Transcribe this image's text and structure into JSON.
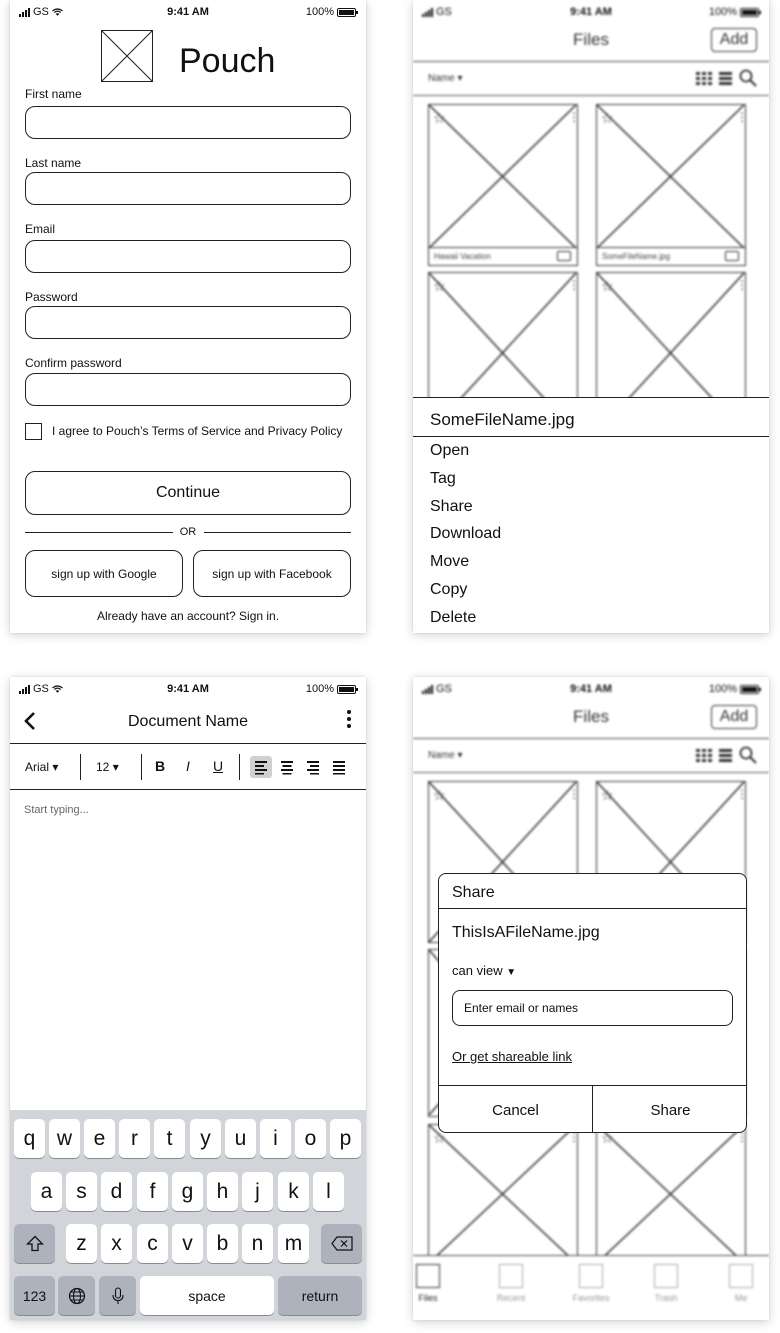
{
  "status_bar": {
    "carrier": "GS",
    "time": "9:41 AM",
    "battery": "100%"
  },
  "signup": {
    "brand": "Pouch",
    "fields": [
      {
        "label": "First name"
      },
      {
        "label": "Last name"
      },
      {
        "label": "Email"
      },
      {
        "label": "Password"
      },
      {
        "label": "Confirm password"
      }
    ],
    "terms_text": "I agree to Pouch’s Terms of Service and Privacy Policy",
    "continue_label": "Continue",
    "or_text": "OR",
    "google_label": "sign up with Google",
    "facebook_label": "sign up with Facebook",
    "signin_text": "Already have an account? Sign in."
  },
  "files": {
    "title": "Files",
    "add_label": "Add",
    "sort_label": "Name ▾",
    "tile_names": [
      "Hawaii Vacation",
      "SomeFileName.jpg"
    ],
    "tabs": [
      "Files",
      "Recent",
      "Favorites",
      "Trash",
      "Me"
    ]
  },
  "action_sheet": {
    "title": "SomeFileName.jpg",
    "items": [
      "Open",
      "Tag",
      "Share",
      "Download",
      "Move",
      "Copy",
      "Delete"
    ]
  },
  "editor": {
    "title": "Document Name",
    "back_icon": "chevron-left-icon",
    "font": "Arial",
    "size": "12",
    "bold": "B",
    "italic": "I",
    "underline": "U",
    "placeholder": "Start typing...",
    "keyboard": {
      "row1": [
        "q",
        "w",
        "e",
        "r",
        "t",
        "y",
        "u",
        "i",
        "o",
        "p"
      ],
      "row2": [
        "a",
        "s",
        "d",
        "f",
        "g",
        "h",
        "j",
        "k",
        "l"
      ],
      "row3": [
        "z",
        "x",
        "c",
        "v",
        "b",
        "n",
        "m"
      ],
      "numbers_label": "123",
      "space_label": "space",
      "return_label": "return"
    }
  },
  "share_dialog": {
    "title": "Share",
    "filename": "ThisIsAFileName.jpg",
    "permission": "can view",
    "input_placeholder": "Enter email or names",
    "link_text": "Or get shareable link",
    "cancel_label": "Cancel",
    "share_label": "Share"
  }
}
